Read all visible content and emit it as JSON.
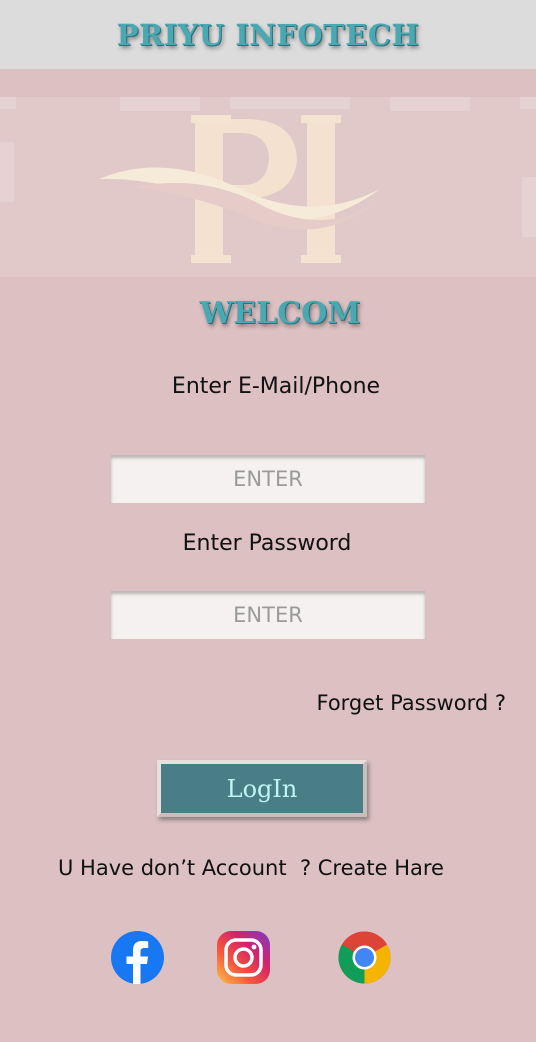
{
  "header": {
    "brand": "PRIYU INFOTECH"
  },
  "banner": {
    "logo_name": "PI monogram logo"
  },
  "welcome": "WELCOM",
  "form": {
    "email_label": "Enter E-Mail/Phone",
    "email_placeholder": "ENTER",
    "password_label": "Enter Password",
    "password_placeholder": "ENTER",
    "forgot_label": "Forget Password ?",
    "login_label": "LogIn"
  },
  "signup": {
    "prompt": "U Have don’t Account  ? ",
    "link": "Create Hare"
  },
  "social": [
    {
      "icon": "facebook-icon"
    },
    {
      "icon": "instagram-icon"
    },
    {
      "icon": "chrome-icon"
    }
  ],
  "colors": {
    "background": "#dcc0c2",
    "header": "#dcdcdc",
    "accent": "#4aa8b2",
    "button": "#4a7e87"
  }
}
